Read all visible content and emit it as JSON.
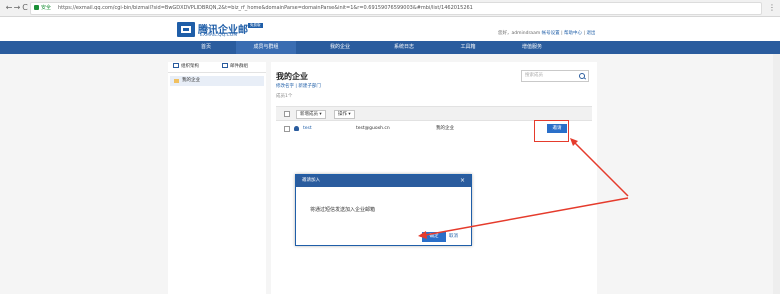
{
  "browser": {
    "secure_label": "安全",
    "url": "https://exmail.qq.com/cgi-bin/bizmail?sid=BwGDXDVPLIDBRQN,2&t=biz_rf_home&domainParse=domainParse&init=1&r=0.69159076599003&#mbi/list/1462015261",
    "back": "←",
    "forward": "→",
    "reload": "C",
    "menu": "⋮"
  },
  "header": {
    "logo_text": "腾讯企业邮",
    "logo_sub": "EXMAIL.QQ.COM",
    "logo_badge": "免费版",
    "greeting": "您好，admindraam",
    "links": [
      "帐号设置",
      "帮助中心",
      "退出"
    ]
  },
  "nav": {
    "items": [
      "首页",
      "成员与群组",
      "我的企业",
      "系统日志",
      "工具箱",
      "增值服务"
    ],
    "active_index": 1
  },
  "sidebar": {
    "tabs": [
      "组织架构",
      "邮件群组"
    ],
    "tree": [
      "我的企业"
    ]
  },
  "main": {
    "title": "我的企业",
    "sub_links": "修改名字 | 新建子部门",
    "count": "成员1个",
    "search_placeholder": "搜索成员",
    "toolbar": {
      "new_member": "新增成员 ▾",
      "action": "操作 ▾"
    },
    "rows": [
      {
        "name": "test",
        "email": "test@guoxh.cn",
        "dept": "我的企业",
        "invite": "邀请"
      }
    ]
  },
  "dialog": {
    "title": "邀请加入",
    "close": "×",
    "message": "将通过短信发送加入企业邮箱",
    "ok": "确定",
    "cancel": "取消"
  },
  "colors": {
    "brand": "#2a5c9e",
    "button": "#2a6fc9",
    "annotation": "#e53b2c"
  }
}
